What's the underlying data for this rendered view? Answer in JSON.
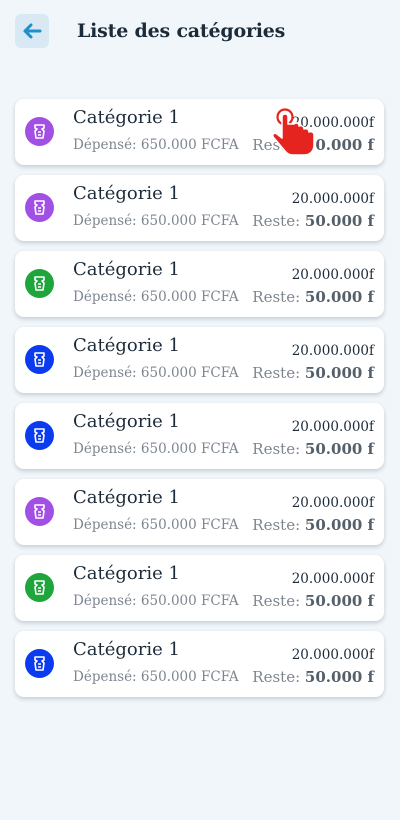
{
  "header": {
    "title": "Liste des catégories",
    "back_icon": "arrow-left-icon"
  },
  "colors": {
    "purple": "#a24fe3",
    "green": "#1ea53b",
    "blue": "#0b3bf0",
    "back_arrow": "#1f8fcc"
  },
  "categories": [
    {
      "name": "Catégorie 1",
      "spent": "Dépensé: 650.000 FCFA",
      "amount": "20.000.000f",
      "rest_label": "Reste:",
      "rest_value": "50.000 f",
      "color": "#a24fe3",
      "icon": "category-icon"
    },
    {
      "name": "Catégorie 1",
      "spent": "Dépensé: 650.000 FCFA",
      "amount": "20.000.000f",
      "rest_label": "Reste:",
      "rest_value": "50.000 f",
      "color": "#a24fe3",
      "icon": "category-icon"
    },
    {
      "name": "Catégorie 1",
      "spent": "Dépensé: 650.000 FCFA",
      "amount": "20.000.000f",
      "rest_label": "Reste:",
      "rest_value": "50.000 f",
      "color": "#1ea53b",
      "icon": "category-icon"
    },
    {
      "name": "Catégorie 1",
      "spent": "Dépensé: 650.000 FCFA",
      "amount": "20.000.000f",
      "rest_label": "Reste:",
      "rest_value": "50.000 f",
      "color": "#0b3bf0",
      "icon": "category-icon"
    },
    {
      "name": "Catégorie 1",
      "spent": "Dépensé: 650.000 FCFA",
      "amount": "20.000.000f",
      "rest_label": "Reste:",
      "rest_value": "50.000 f",
      "color": "#0b3bf0",
      "icon": "category-icon"
    },
    {
      "name": "Catégorie 1",
      "spent": "Dépensé: 650.000 FCFA",
      "amount": "20.000.000f",
      "rest_label": "Reste:",
      "rest_value": "50.000 f",
      "color": "#a24fe3",
      "icon": "category-icon"
    },
    {
      "name": "Catégorie 1",
      "spent": "Dépensé: 650.000 FCFA",
      "amount": "20.000.000f",
      "rest_label": "Reste:",
      "rest_value": "50.000 f",
      "color": "#1ea53b",
      "icon": "category-icon"
    },
    {
      "name": "Catégorie 1",
      "spent": "Dépensé: 650.000 FCFA",
      "amount": "20.000.000f",
      "rest_label": "Reste:",
      "rest_value": "50.000 f",
      "color": "#0b3bf0",
      "icon": "category-icon"
    }
  ],
  "overlay": {
    "icon": "tap-hand-cursor-icon"
  }
}
